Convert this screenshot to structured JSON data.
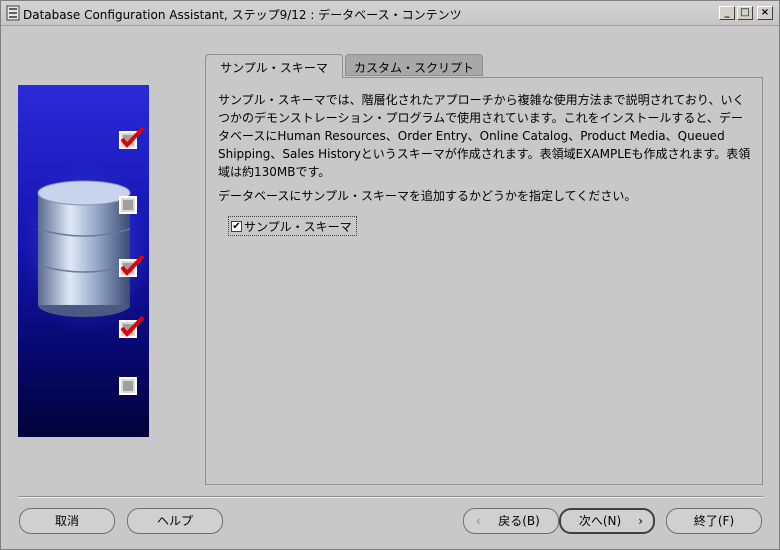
{
  "window": {
    "title": "Database Configuration Assistant, ステップ9/12 : データベース・コンテンツ",
    "minimize": "_",
    "maximize": "□",
    "close": "×"
  },
  "tabs": [
    {
      "label": "サンプル・スキーマ",
      "active": true
    },
    {
      "label": "カスタム・スクリプト",
      "active": false
    }
  ],
  "content": {
    "description": "サンプル・スキーマでは、階層化されたアプローチから複雑な使用方法まで説明されており、いくつかのデモンストレーション・プログラムで使用されています。これをインストールすると、データベースにHuman Resources、Order Entry、Online Catalog、Product Media、Queued Shipping、Sales Historyというスキーマが作成されます。表領域EXAMPLEも作成されます。表領域は約130MBです。",
    "prompt": "データベースにサンプル・スキーマを追加するかどうかを指定してください。",
    "checkbox_label": "サンプル・スキーマ",
    "checkbox_checked": true
  },
  "sidebar_steps": [
    {
      "checked": true
    },
    {
      "checked": false
    },
    {
      "checked": true
    },
    {
      "checked": true
    },
    {
      "checked": false
    }
  ],
  "buttons": {
    "cancel": "取消",
    "help": "ヘルプ",
    "back": "戻る(B)",
    "next": "次へ(N)",
    "finish": "終了(F)"
  },
  "colors": {
    "panel_top": "#2a2ad8",
    "panel_bottom": "#02023a",
    "check_red": "#e00000"
  }
}
